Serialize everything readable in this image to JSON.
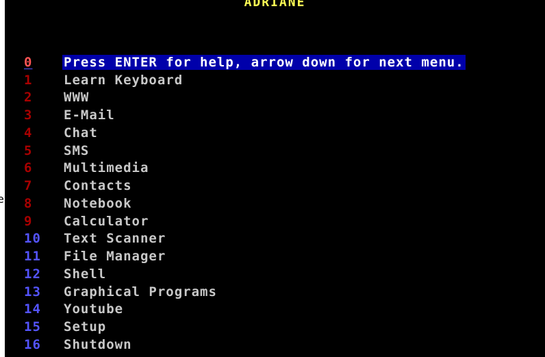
{
  "title": "ADRIANE",
  "edge_fragment": "e",
  "menu": {
    "items": [
      {
        "number": "0",
        "label": "Press ENTER for help, arrow down for next menu.",
        "color": "red",
        "selected": true
      },
      {
        "number": "1",
        "label": "Learn Keyboard",
        "color": "red",
        "selected": false
      },
      {
        "number": "2",
        "label": "WWW",
        "color": "red",
        "selected": false
      },
      {
        "number": "3",
        "label": "E-Mail",
        "color": "red",
        "selected": false
      },
      {
        "number": "4",
        "label": "Chat",
        "color": "red",
        "selected": false
      },
      {
        "number": "5",
        "label": "SMS",
        "color": "red",
        "selected": false
      },
      {
        "number": "6",
        "label": "Multimedia",
        "color": "red",
        "selected": false
      },
      {
        "number": "7",
        "label": "Contacts",
        "color": "red",
        "selected": false
      },
      {
        "number": "8",
        "label": "Notebook",
        "color": "red",
        "selected": false
      },
      {
        "number": "9",
        "label": "Calculator",
        "color": "red",
        "selected": false
      },
      {
        "number": "10",
        "label": "Text Scanner",
        "color": "blue",
        "selected": false
      },
      {
        "number": "11",
        "label": "File Manager",
        "color": "blue",
        "selected": false
      },
      {
        "number": "12",
        "label": "Shell",
        "color": "blue",
        "selected": false
      },
      {
        "number": "13",
        "label": "Graphical Programs",
        "color": "blue",
        "selected": false
      },
      {
        "number": "14",
        "label": "Youtube",
        "color": "blue",
        "selected": false
      },
      {
        "number": "15",
        "label": "Setup",
        "color": "blue",
        "selected": false
      },
      {
        "number": "16",
        "label": "Shutdown",
        "color": "blue",
        "selected": false
      }
    ]
  },
  "colors": {
    "background": "#000000",
    "title": "#ffff54",
    "number_red": "#a80000",
    "number_blue": "#5454ff",
    "label": "#c8c8c8",
    "selection_background": "#0000aa"
  }
}
